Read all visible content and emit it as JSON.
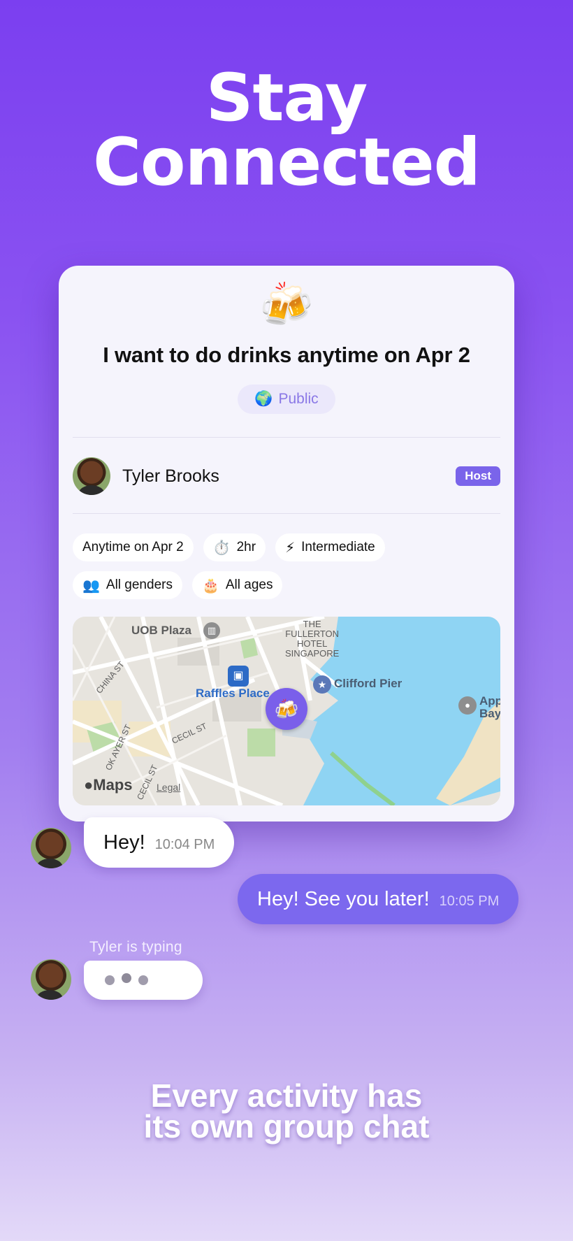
{
  "headline": {
    "line1": "Stay",
    "line2": "Connected"
  },
  "card": {
    "emoji": "🍻",
    "title": "I want to do drinks anytime on Apr 2",
    "visibility": {
      "icon": "🌍",
      "label": "Public"
    },
    "host": {
      "name": "Tyler Brooks",
      "badge": "Host"
    },
    "chips_row1": [
      {
        "icon": "",
        "label": "Anytime on Apr 2"
      },
      {
        "icon": "⏱️",
        "label": "2hr"
      },
      {
        "icon": "⚡",
        "label": "Intermediate"
      }
    ],
    "chips_row2": [
      {
        "icon": "👥",
        "label": "All genders"
      },
      {
        "icon": "🎂",
        "label": "All ages"
      }
    ],
    "map": {
      "labels": {
        "uob": "UOB Plaza",
        "fullerton1": "THE",
        "fullerton2": "FULLERTON",
        "fullerton3": "HOTEL",
        "fullerton4": "SINGAPORE",
        "raffles": "Raffles Place",
        "clifford": "Clifford Pier",
        "apple1": "App",
        "apple2": "Bay",
        "china_st": "CHINA ST",
        "cecil_st": "CECIL ST",
        "cecil_st2": "CECIL ST",
        "ayer_st": "OK AYER ST"
      },
      "pin_icon": "🍻",
      "brand": "Maps",
      "legal": "Legal"
    }
  },
  "chat": {
    "msg1": {
      "text": "Hey!",
      "time": "10:04 PM"
    },
    "msg2": {
      "text": "Hey! See you later!",
      "time": "10:05 PM"
    },
    "typing": "Tyler is typing"
  },
  "caption": {
    "line1": "Every activity has",
    "line2": "its own group chat"
  }
}
